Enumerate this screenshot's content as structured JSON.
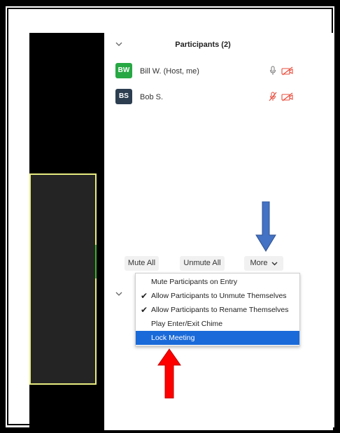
{
  "participants_panel": {
    "title": "Participants (2)",
    "participants": [
      {
        "initials": "BW",
        "name": "Bill W. (Host, me)",
        "avatar_color": "#27a844",
        "mic": "mic-on",
        "video": "video-off"
      },
      {
        "initials": "BS",
        "name": "Bob S.",
        "avatar_color": "#2c3e50",
        "mic": "mic-off",
        "video": "video-off"
      }
    ],
    "buttons": {
      "mute_all": "Mute All",
      "unmute_all": "Unmute All",
      "more": "More",
      "more_caret": "⌵"
    }
  },
  "more_menu": {
    "items": [
      {
        "label": "Mute Participants on Entry",
        "checked": false,
        "selected": false
      },
      {
        "label": "Allow Participants to Unmute Themselves",
        "checked": true,
        "selected": false
      },
      {
        "label": "Allow Participants to Rename Themselves",
        "checked": true,
        "selected": false
      },
      {
        "label": "Play Enter/Exit Chime",
        "checked": false,
        "selected": false
      },
      {
        "label": "Lock Meeting",
        "checked": false,
        "selected": true
      }
    ],
    "check_glyph": "✔"
  },
  "annotations": {
    "blue_arrow_color": "#4472c4",
    "red_arrow_color": "#ff0000"
  },
  "colors": {
    "menu_selection": "#1a6ad9",
    "muted_red": "#e74c3c"
  }
}
